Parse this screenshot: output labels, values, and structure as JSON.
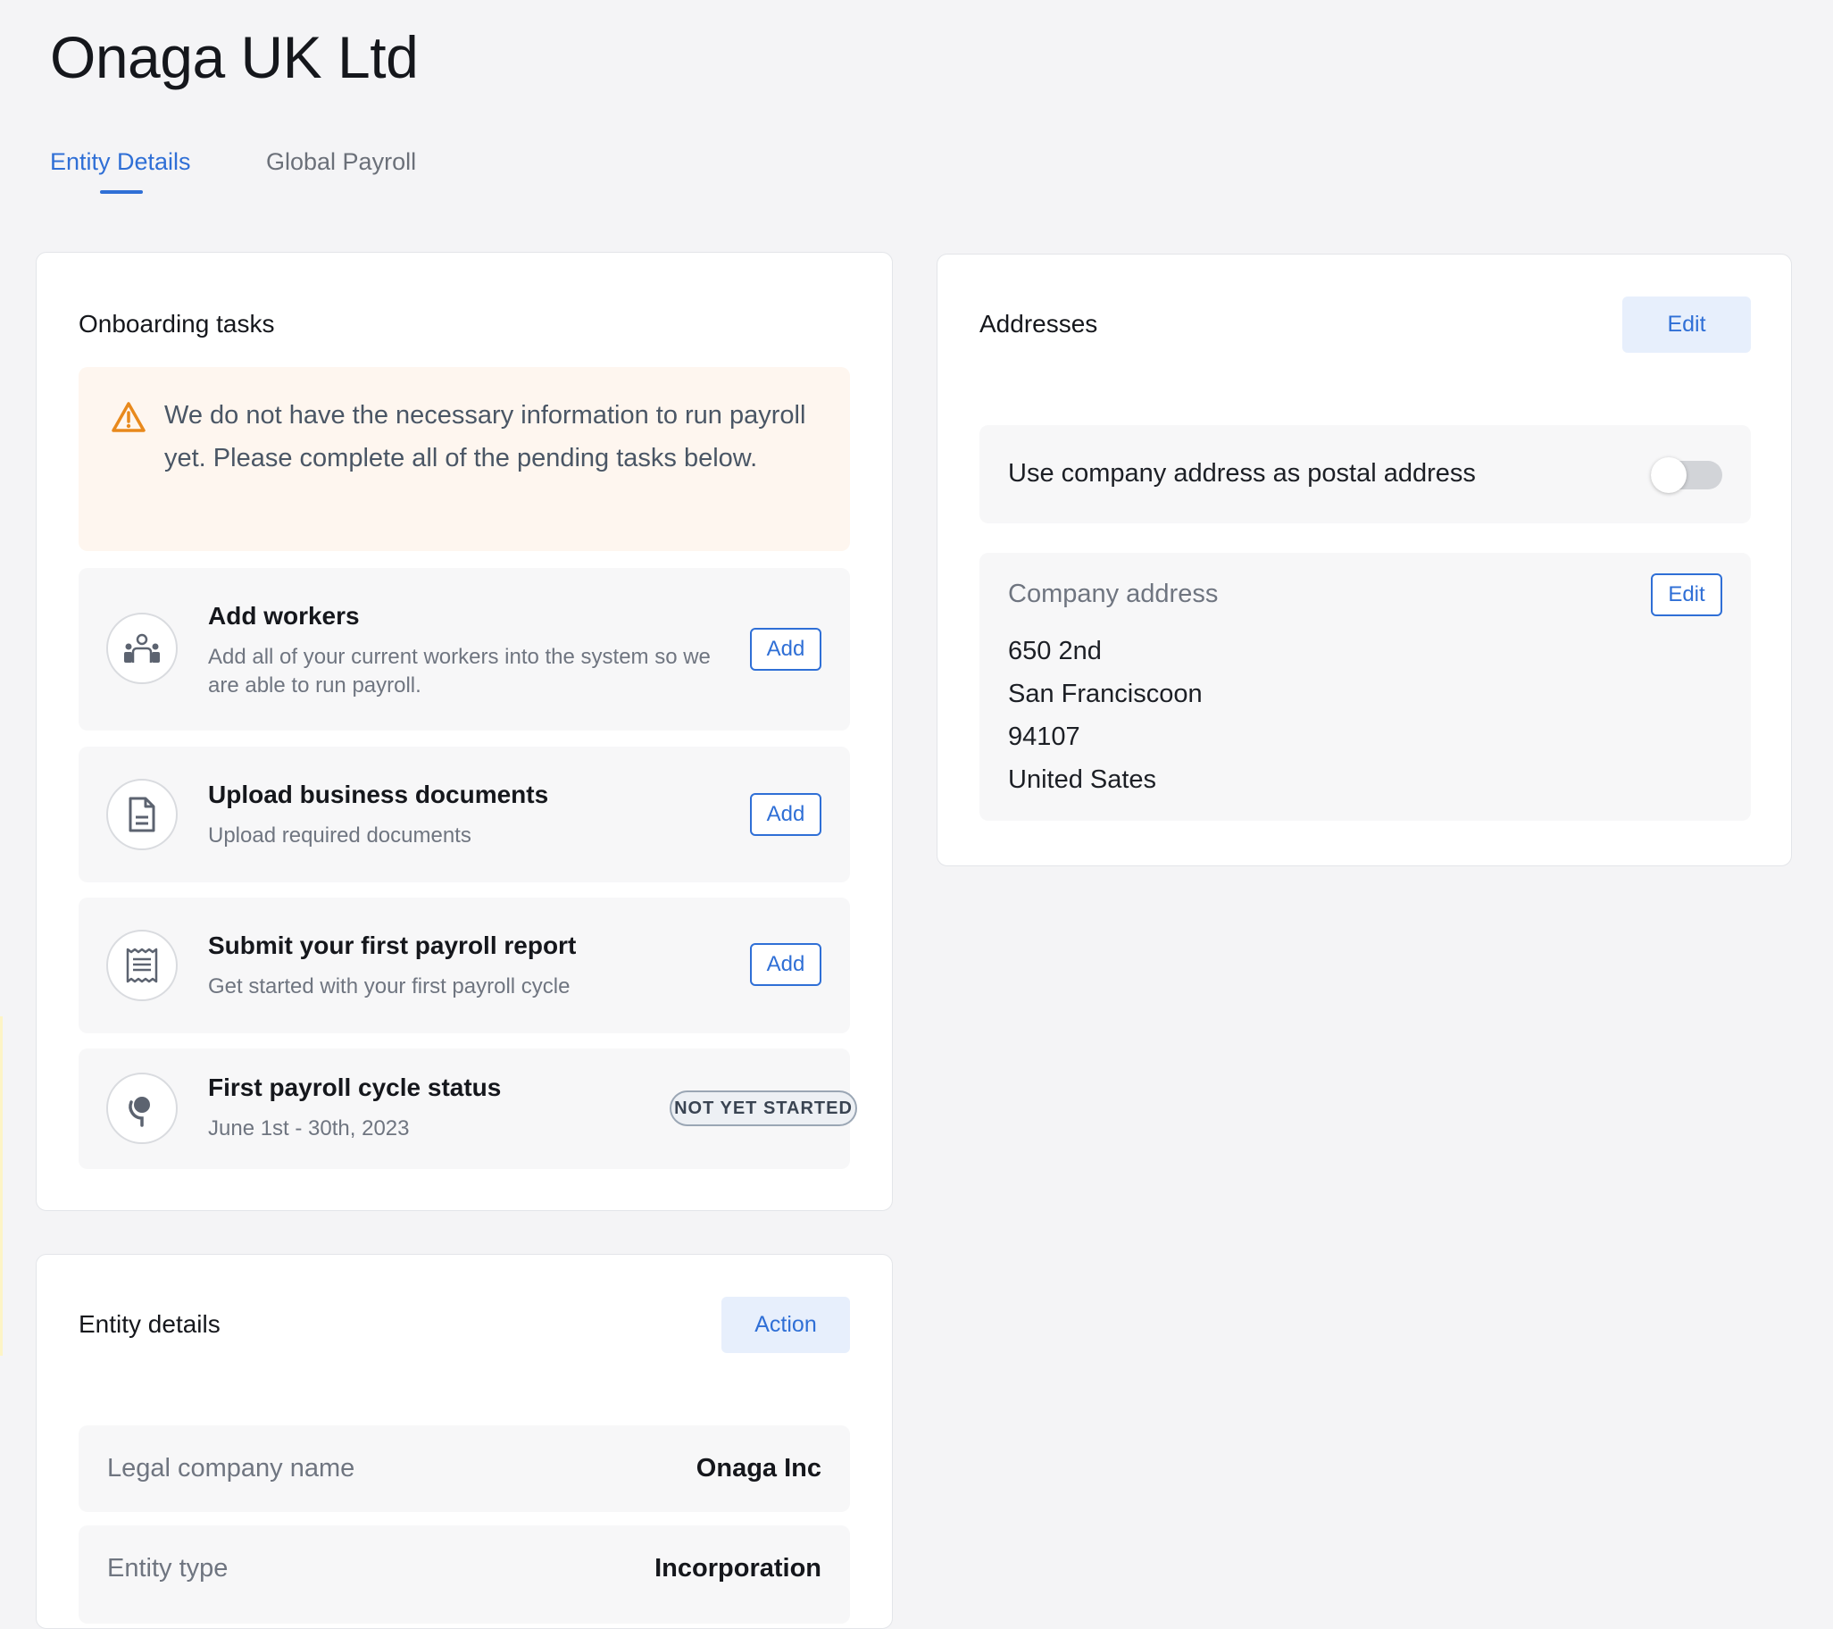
{
  "page": {
    "title": "Onaga UK Ltd"
  },
  "tabs": [
    {
      "label": "Entity Details",
      "active": true
    },
    {
      "label": "Global Payroll",
      "active": false
    }
  ],
  "onboarding": {
    "title": "Onboarding tasks",
    "warning": {
      "icon": "warning-triangle-icon",
      "text": "We do not have the necessary information to run payroll yet. Please complete all of the pending tasks below."
    },
    "tasks": [
      {
        "icon": "workers-icon",
        "title": "Add workers",
        "description": "Add all of your current workers into the system so we are able to run payroll.",
        "button": "Add"
      },
      {
        "icon": "document-icon",
        "title": "Upload business documents",
        "description": "Upload required documents",
        "button": "Add"
      },
      {
        "icon": "receipt-icon",
        "title": "Submit your first payroll report",
        "description": "Get started with your first payroll cycle",
        "button": "Add"
      },
      {
        "icon": "cycle-status-icon",
        "title": "First payroll cycle status",
        "description": "June 1st - 30th, 2023",
        "badge": "NOT YET STARTED"
      }
    ]
  },
  "addresses": {
    "title": "Addresses",
    "edit_label": "Edit",
    "postal_toggle": {
      "label": "Use company address as postal address",
      "checked": false
    },
    "company_address": {
      "label": "Company address",
      "edit_label": "Edit",
      "lines": [
        "650 2nd",
        "San Franciscoon",
        "94107",
        "United Sates"
      ]
    }
  },
  "entity_details": {
    "title": "Entity details",
    "action_label": "Action",
    "rows": [
      {
        "label": "Legal company name",
        "value": "Onaga Inc"
      },
      {
        "label": "Entity type",
        "value": "Incorporation"
      }
    ]
  },
  "colors": {
    "accent": "#2f6fd6",
    "warning_bg": "#fef6ef",
    "warning_icon": "#e8891c",
    "page_bg": "#f4f4f6"
  }
}
